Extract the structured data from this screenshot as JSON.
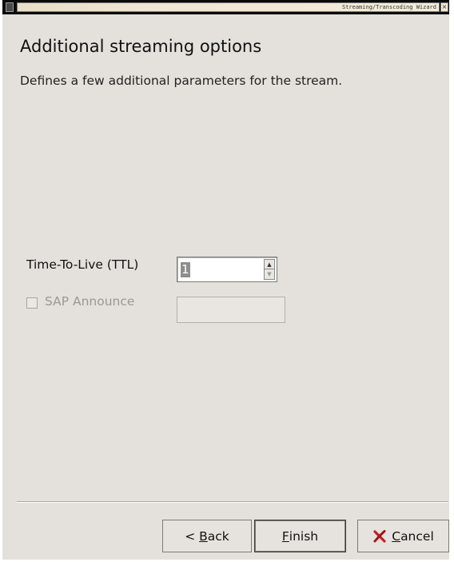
{
  "window": {
    "title": "Streaming/Transcoding Wizard",
    "close_glyph": "×"
  },
  "page": {
    "heading": "Additional streaming options",
    "subheading": "Defines a few additional parameters for the stream."
  },
  "ttl": {
    "label": "Time-To-Live (TTL)",
    "value": "1",
    "up_glyph": "▲",
    "down_glyph": "▼"
  },
  "sap": {
    "label": "SAP Announce",
    "checked": false,
    "enabled": false,
    "field_value": ""
  },
  "buttons": {
    "back": {
      "prefix": "< ",
      "mnemonic": "B",
      "rest": "ack"
    },
    "finish": {
      "prefix": "",
      "mnemonic": "F",
      "rest": "inish"
    },
    "cancel": {
      "prefix": "",
      "mnemonic": "C",
      "rest": "ancel",
      "icon": "cancel-x-icon"
    }
  },
  "colors": {
    "window_bg": "#e4e1dc",
    "disabled_text": "#9b9893",
    "cancel_icon": "#c81e1e"
  }
}
